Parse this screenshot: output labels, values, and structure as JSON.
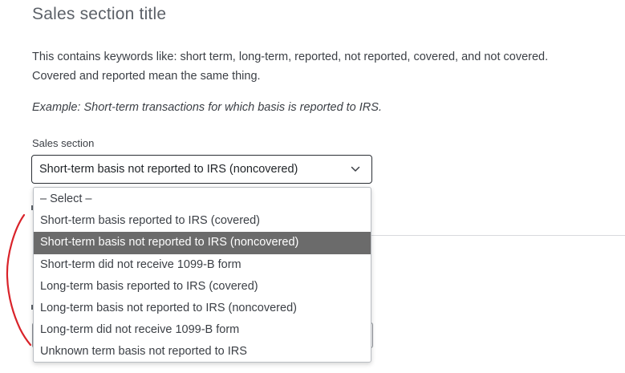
{
  "section": {
    "title": "Sales section title",
    "description_line1": "This contains keywords like: short term, long-term, reported, not reported, covered, and not covered.",
    "description_line2": "Covered and reported mean the same thing.",
    "example": "Example: Short-term transactions for which basis is reported to IRS."
  },
  "sales_select": {
    "label": "Sales section",
    "value": "Short-term basis not reported to IRS (noncovered)",
    "icon": "chevron-down-icon",
    "options": [
      "– Select –",
      "Short-term basis reported to IRS (covered)",
      "Short-term basis not reported to IRS (noncovered)",
      "Short-term did not receive 1099-B form",
      "Long-term basis reported to IRS (covered)",
      "Long-term basis not reported to IRS (noncovered)",
      "Long-term did not receive 1099-B form",
      "Unknown term basis not reported to IRS"
    ],
    "selected_index": 2
  },
  "colors": {
    "highlight": "#6b6b6b",
    "annotation_stroke": "#d9232a",
    "title": "#5c6168"
  }
}
